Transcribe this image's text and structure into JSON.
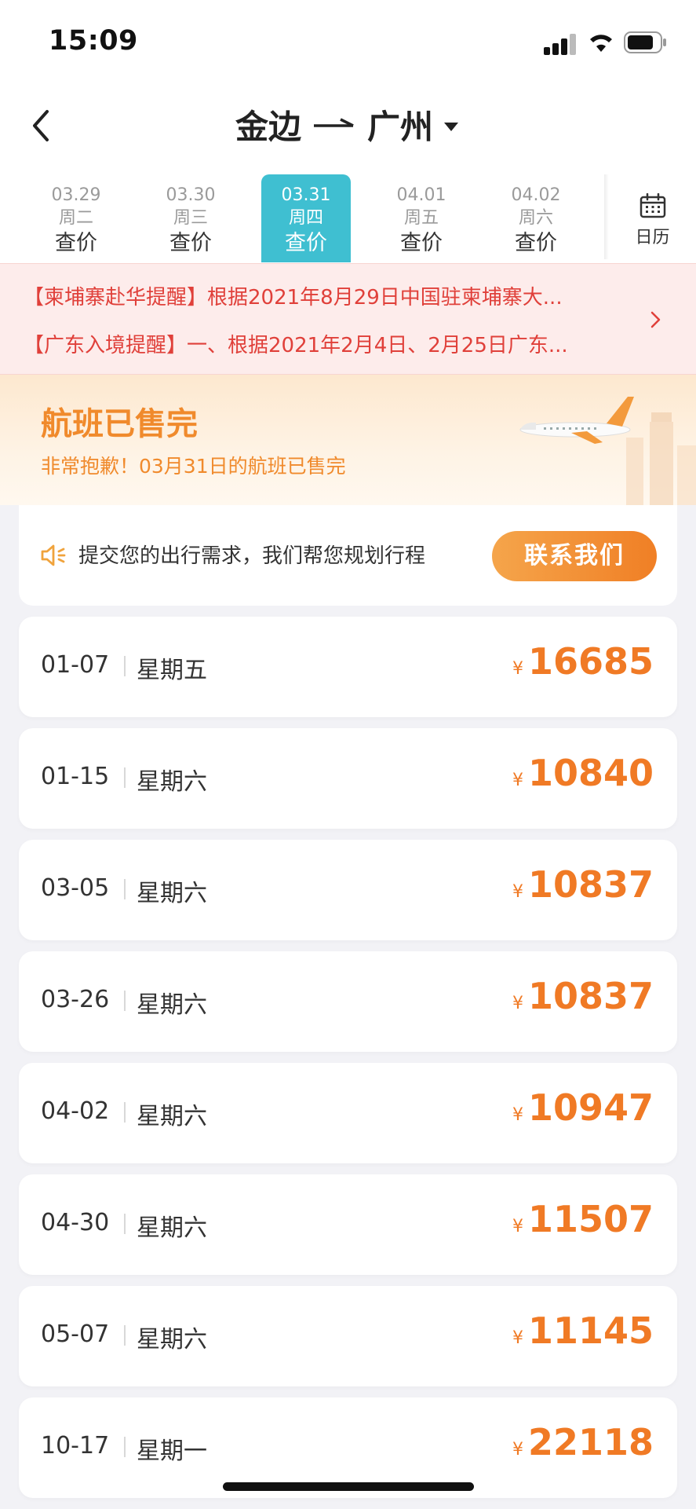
{
  "status_bar": {
    "time": "15:09"
  },
  "header": {
    "origin": "金边",
    "destination": "广州"
  },
  "date_tabs": [
    {
      "date": "03.29",
      "weekday": "周二",
      "price_label": "查价",
      "active": false
    },
    {
      "date": "03.30",
      "weekday": "周三",
      "price_label": "查价",
      "active": false
    },
    {
      "date": "03.31",
      "weekday": "周四",
      "price_label": "查价",
      "active": true
    },
    {
      "date": "04.01",
      "weekday": "周五",
      "price_label": "查价",
      "active": false
    },
    {
      "date": "04.02",
      "weekday": "周六",
      "price_label": "查价",
      "active": false
    }
  ],
  "calendar": {
    "label": "日历"
  },
  "notices": [
    "【柬埔寨赴华提醒】根据2021年8月29日中国驻柬埔寨大...",
    "【广东入境提醒】一、根据2021年2月4日、2月25日广东..."
  ],
  "sold_out": {
    "title": "航班已售完",
    "message": "非常抱歉！03月31日的航班已售完"
  },
  "contact": {
    "text": "提交您的出行需求，我们帮您规划行程",
    "button_label": "联系我们"
  },
  "currency_symbol": "¥",
  "fares": [
    {
      "date": "01-07",
      "weekday": "星期五",
      "price": "16685"
    },
    {
      "date": "01-15",
      "weekday": "星期六",
      "price": "10840"
    },
    {
      "date": "03-05",
      "weekday": "星期六",
      "price": "10837"
    },
    {
      "date": "03-26",
      "weekday": "星期六",
      "price": "10837"
    },
    {
      "date": "04-02",
      "weekday": "星期六",
      "price": "10947"
    },
    {
      "date": "04-30",
      "weekday": "星期六",
      "price": "11507"
    },
    {
      "date": "05-07",
      "weekday": "星期六",
      "price": "11145"
    },
    {
      "date": "10-17",
      "weekday": "星期一",
      "price": "22118"
    }
  ],
  "colors": {
    "accent_teal": "#3fbfd1",
    "price_orange": "#f07a25",
    "notice_red": "#e0403a"
  }
}
